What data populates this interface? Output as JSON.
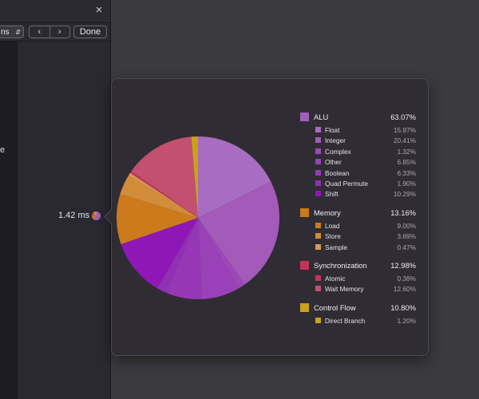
{
  "window": {
    "close_glyph": "×"
  },
  "toolbar": {
    "select_value": "ns",
    "back_glyph": "‹",
    "forward_glyph": "›",
    "done_label": "Done"
  },
  "left_content": {
    "fragment": "e"
  },
  "timeline": {
    "time_label": "1.42 ms"
  },
  "legend": [
    {
      "name": "ALU",
      "percent": "63.07%",
      "color": "#a15fb8",
      "items": [
        {
          "name": "Float",
          "percent": "15.97%",
          "color": "#a86cc1"
        },
        {
          "name": "Integer",
          "percent": "20.41%",
          "color": "#a35ab9"
        },
        {
          "name": "Complex",
          "percent": "1.32%",
          "color": "#9e48b8"
        },
        {
          "name": "Other",
          "percent": "6.85%",
          "color": "#9a40b8"
        },
        {
          "name": "Boolean",
          "percent": "6.33%",
          "color": "#9638b5"
        },
        {
          "name": "Quad Permute",
          "percent": "1.90%",
          "color": "#9230b5"
        },
        {
          "name": "Shift",
          "percent": "10.29%",
          "color": "#8e17b6"
        }
      ]
    },
    {
      "name": "Memory",
      "percent": "13.16%",
      "color": "#c9791a",
      "items": [
        {
          "name": "Load",
          "percent": "9.00%",
          "color": "#cc7a1c"
        },
        {
          "name": "Store",
          "percent": "3.69%",
          "color": "#d28c3a"
        },
        {
          "name": "Sample",
          "percent": "0.47%",
          "color": "#d49a5a"
        }
      ]
    },
    {
      "name": "Synchronization",
      "percent": "12.98%",
      "color": "#c8325a",
      "items": [
        {
          "name": "Atomic",
          "percent": "0.38%",
          "color": "#c8325a"
        },
        {
          "name": "Wait Memory",
          "percent": "12.60%",
          "color": "#c2506e"
        }
      ]
    },
    {
      "name": "Control Flow",
      "percent": "10.80%",
      "color": "#c9a21a",
      "items": [
        {
          "name": "Direct Branch",
          "percent": "1.20%",
          "color": "#c9a21a"
        }
      ]
    }
  ],
  "chart_data": {
    "type": "pie",
    "title": "",
    "slices": [
      {
        "label": "Float",
        "value": 15.97,
        "color": "#a86cc1"
      },
      {
        "label": "Integer",
        "value": 20.41,
        "color": "#a35ab9"
      },
      {
        "label": "Complex",
        "value": 1.32,
        "color": "#9e48b8"
      },
      {
        "label": "Other",
        "value": 6.85,
        "color": "#9a40b8"
      },
      {
        "label": "Boolean",
        "value": 6.33,
        "color": "#9638b5"
      },
      {
        "label": "Quad Permute",
        "value": 1.9,
        "color": "#9230b5"
      },
      {
        "label": "Shift",
        "value": 10.29,
        "color": "#8e17b6"
      },
      {
        "label": "Load",
        "value": 9.0,
        "color": "#cc7a1c"
      },
      {
        "label": "Store",
        "value": 3.69,
        "color": "#d28c3a"
      },
      {
        "label": "Sample",
        "value": 0.47,
        "color": "#d49a5a"
      },
      {
        "label": "Atomic",
        "value": 0.38,
        "color": "#c8325a"
      },
      {
        "label": "Wait Memory",
        "value": 12.6,
        "color": "#c2506e"
      },
      {
        "label": "Direct Branch",
        "value": 1.2,
        "color": "#c9a21a"
      }
    ]
  }
}
